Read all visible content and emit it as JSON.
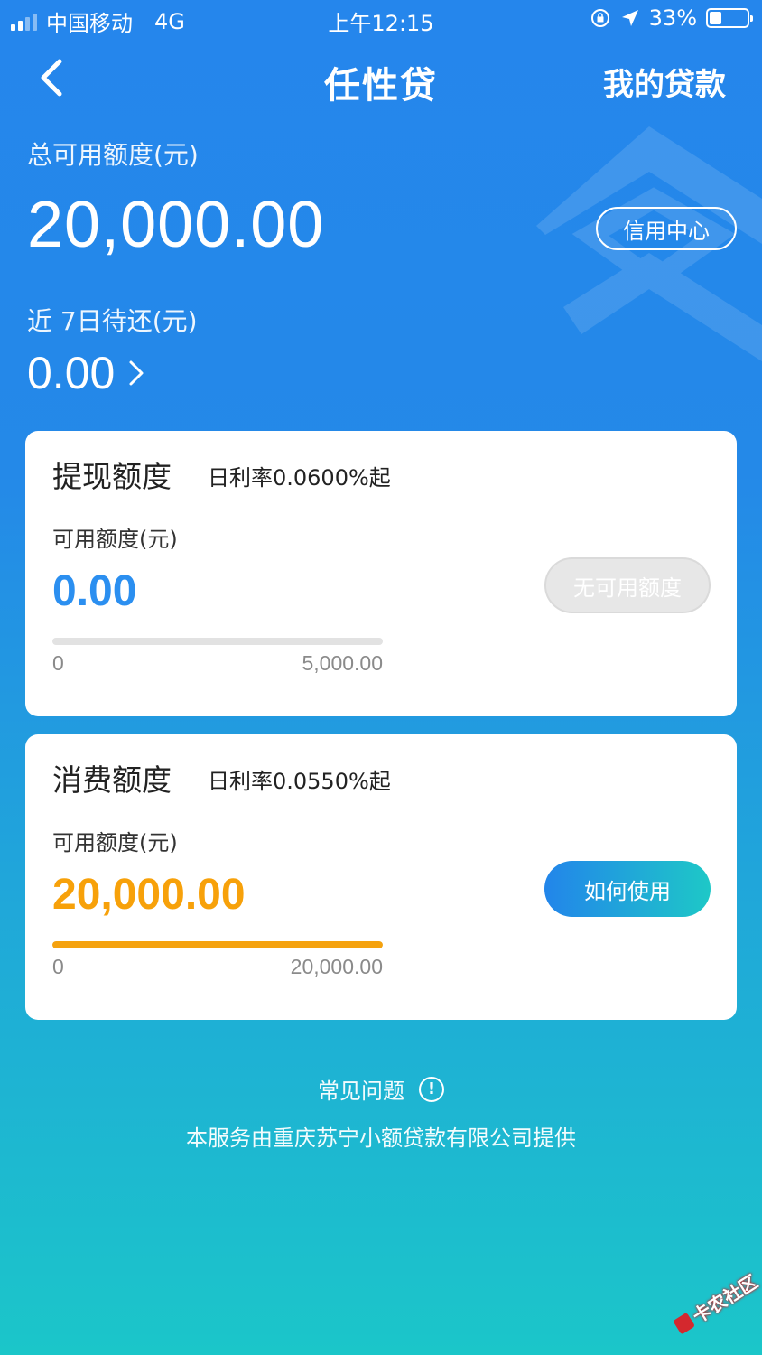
{
  "status_bar": {
    "carrier": "中国移动",
    "network": "4G",
    "time": "上午12:15",
    "battery": "33%",
    "battery_level": 0.33
  },
  "nav": {
    "title": "任性贷",
    "right_link": "我的贷款"
  },
  "summary": {
    "total_label": "总可用额度(元)",
    "total_amount": "20,000.00",
    "credit_center_button": "信用中心",
    "due_label": "近 7日待还(元)",
    "due_amount": "0.00"
  },
  "cards": [
    {
      "title": "提现额度",
      "rate": "日利率0.0600%起",
      "sub_label": "可用额度(元)",
      "amount": "0.00",
      "amount_color": "#2b8ff0",
      "bar_min": "0",
      "bar_max": "5,000.00",
      "bar_fraction": 0,
      "bar_color": "#e2e2e2",
      "button": "无可用额度",
      "button_enabled": false
    },
    {
      "title": "消费额度",
      "rate": "日利率0.0550%起",
      "sub_label": "可用额度(元)",
      "amount": "20,000.00",
      "amount_color": "#f7a10a",
      "bar_min": "0",
      "bar_max": "20,000.00",
      "bar_fraction": 1,
      "bar_color": "#f5a20e",
      "button": "如何使用",
      "button_enabled": true
    }
  ],
  "footer": {
    "faq": "常见问题",
    "faq_icon": "!",
    "provider": "本服务由重庆苏宁小额贷款有限公司提供"
  },
  "watermark": "卡农社区"
}
